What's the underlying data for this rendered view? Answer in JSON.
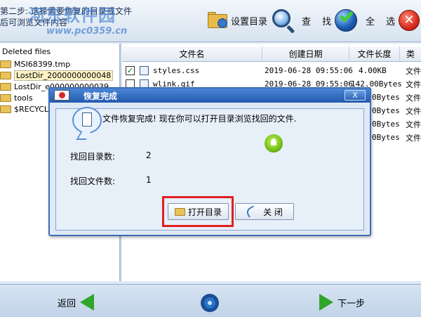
{
  "toolbar": {
    "hint_line1": "第二步: 选择需要恢复的目录或文件",
    "hint_line2": "后可浏览文件内容",
    "watermark": "河东软件园",
    "watermark_url": "www.pc0359.cn",
    "set_dir_label": "设置目录",
    "find_label": "查 找",
    "select_all_label": "全 选",
    "close_symbol": "✕"
  },
  "tree": {
    "root_label": "Deleted files",
    "items": [
      {
        "label": "MSI68399.tmp"
      },
      {
        "label": "LostDir_2000000000048"
      },
      {
        "label": "LostDir_e000000000039"
      },
      {
        "label": "tools"
      },
      {
        "label": "$RECYCLE"
      }
    ]
  },
  "file_list": {
    "columns": [
      "文件名",
      "创建日期",
      "文件长度",
      "类"
    ],
    "rows": [
      {
        "checked": true,
        "name": "styles.css",
        "date": "2019-06-28 09:55:06",
        "size": "4.00KB",
        "type": "文件"
      },
      {
        "checked": false,
        "name": "wlink.gif",
        "date": "2019-06-28 09:55:06",
        "size": "142.00Bytes",
        "type": "文件"
      },
      {
        "checked": false,
        "name": "",
        "date": "",
        "size": "0Bytes",
        "type": "文件"
      },
      {
        "checked": false,
        "name": "",
        "date": "",
        "size": "0Bytes",
        "type": "文件"
      },
      {
        "checked": false,
        "name": "",
        "date": "",
        "size": "0Bytes",
        "type": "文件"
      },
      {
        "checked": false,
        "name": "",
        "date": "",
        "size": "0Bytes",
        "type": "文件"
      }
    ]
  },
  "dialog": {
    "title": "恢复完成",
    "close_symbol": "X",
    "message": "文件恢复完成! 现在你可以打开目录浏览找回的文件.",
    "dirs_label": "找回目录数:",
    "dirs_value": "2",
    "files_label": "找回文件数:",
    "files_value": "1",
    "open_dir_label": "打开目录",
    "close_label": "关  闭"
  },
  "bottombar": {
    "back_label": "返回",
    "next_label": "下一步"
  },
  "colors": {
    "accent": "#2259ad",
    "highlight_frame": "#e02020",
    "nav_arrow": "#2fa52a"
  }
}
